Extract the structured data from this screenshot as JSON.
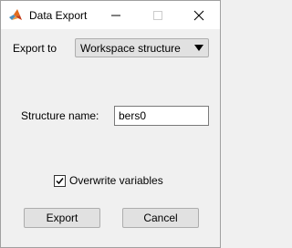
{
  "window": {
    "title": "Data Export"
  },
  "export_to": {
    "label": "Export to",
    "selected": "Workspace structure"
  },
  "structure": {
    "label": "Structure name:",
    "value": "bers0"
  },
  "overwrite": {
    "label": "Overwrite variables",
    "checked": true
  },
  "buttons": {
    "export_label": "Export",
    "cancel_label": "Cancel"
  },
  "icons": {
    "app": "matlab-logo-icon",
    "minimize": "minimize-icon",
    "maximize": "maximize-icon",
    "close": "close-icon",
    "dropdown": "triangle-down-icon",
    "check": "checkmark-icon"
  }
}
